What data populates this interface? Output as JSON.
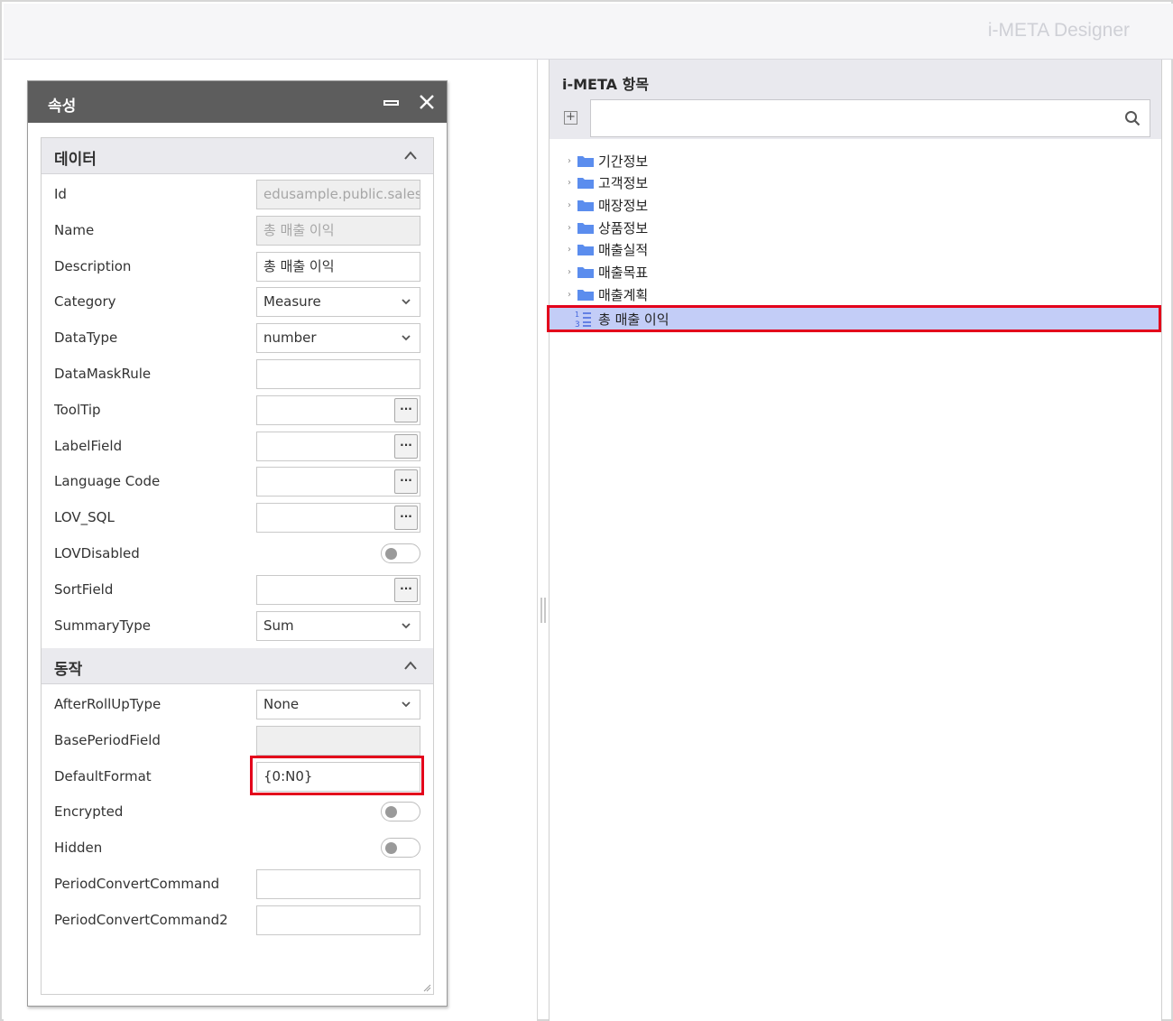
{
  "app": {
    "title": "i-META Designer"
  },
  "property_panel": {
    "title": "속성",
    "sections": {
      "data": "데이터",
      "behavior": "동작"
    },
    "data_rows": [
      {
        "label": "Id",
        "type": "text",
        "value": "edusample.public.sales",
        "disabled": true
      },
      {
        "label": "Name",
        "type": "text",
        "value": "총 매출 이익",
        "disabled": true
      },
      {
        "label": "Description",
        "type": "text",
        "value": "총 매출 이익"
      },
      {
        "label": "Category",
        "type": "select",
        "value": "Measure"
      },
      {
        "label": "DataType",
        "type": "select",
        "value": "number"
      },
      {
        "label": "DataMaskRule",
        "type": "text",
        "value": ""
      },
      {
        "label": "ToolTip",
        "type": "button",
        "value": ""
      },
      {
        "label": "LabelField",
        "type": "button",
        "value": ""
      },
      {
        "label": "Language Code",
        "type": "button",
        "value": ""
      },
      {
        "label": "LOV_SQL",
        "type": "button",
        "value": ""
      },
      {
        "label": "LOVDisabled",
        "type": "toggle",
        "value": false
      },
      {
        "label": "SortField",
        "type": "button",
        "value": ""
      },
      {
        "label": "SummaryType",
        "type": "select",
        "value": "Sum"
      }
    ],
    "behavior_rows": [
      {
        "label": "AfterRollUpType",
        "type": "select",
        "value": "None"
      },
      {
        "label": "BasePeriodField",
        "type": "text",
        "value": "",
        "disabled": true
      },
      {
        "label": "DefaultFormat",
        "type": "text",
        "value": "{0:N0}"
      },
      {
        "label": "Encrypted",
        "type": "toggle",
        "value": false
      },
      {
        "label": "Hidden",
        "type": "toggle",
        "value": false
      },
      {
        "label": "PeriodConvertCommand",
        "type": "text",
        "value": ""
      },
      {
        "label": "PeriodConvertCommand2",
        "type": "text",
        "value": ""
      }
    ],
    "button_glyph": "···"
  },
  "meta_panel": {
    "title": "i-META 항목",
    "search": {
      "placeholder": "",
      "value": ""
    },
    "folders": [
      "기간정보",
      "고객정보",
      "매장정보",
      "상품정보",
      "매출실적",
      "매출목표",
      "매출계획"
    ],
    "selected_item": {
      "label": "총 매출 이익",
      "icon": "numeric-measure-icon"
    }
  },
  "colors": {
    "accent_highlight": "#e3001b",
    "selection": "#c3cdf7",
    "folder": "#5b8dee",
    "titlebar": "#5d5d5d"
  }
}
